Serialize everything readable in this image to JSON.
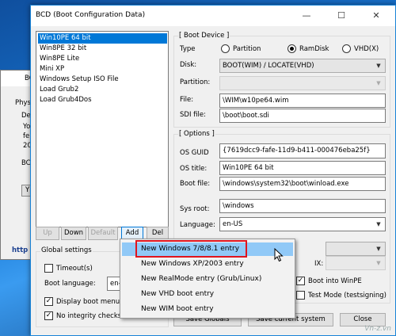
{
  "background_window": {
    "title_fragment": "BC",
    "tab_fragment": "Phys",
    "group_fragment": "De",
    "lines": [
      "Yo",
      "fe",
      "20"
    ],
    "group2_fragment": "BC",
    "button_fragment": "Y",
    "link_fragment": "http"
  },
  "window": {
    "title": "BCD (Boot Configuration Data)",
    "minimize": "—",
    "maximize": "☐",
    "close": "✕"
  },
  "entries": [
    {
      "label": "Win10PE 64 bit",
      "selected": true
    },
    {
      "label": "Win8PE 32 bit",
      "selected": false
    },
    {
      "label": "Win8PE Lite",
      "selected": false
    },
    {
      "label": "Mini XP",
      "selected": false
    },
    {
      "label": "Windows Setup ISO File",
      "selected": false
    },
    {
      "label": "Load Grub2",
      "selected": false
    },
    {
      "label": "Load Grub4Dos",
      "selected": false
    }
  ],
  "list_buttons": {
    "up": "Up",
    "down": "Down",
    "default": "Default",
    "add": "Add",
    "del": "Del"
  },
  "boot_device": {
    "group_label": "[ Boot Device ]",
    "type_label": "Type",
    "type_options": [
      "Partition",
      "RamDisk",
      "VHD(X)"
    ],
    "type_selected": "RamDisk",
    "disk_label": "Disk:",
    "disk_value": "BOOT(WIM) / LOCATE(VHD)",
    "partition_label": "Partition:",
    "partition_value": "",
    "file_label": "File:",
    "file_value": "\\WIM\\w10pe64.wim",
    "sdi_label": "SDI file:",
    "sdi_value": "\\boot\\boot.sdi"
  },
  "options": {
    "group_label": "[ Options ]",
    "guid_label": "OS GUID",
    "guid_value": "{7619dcc9-fafe-11d9-b411-000476eba25f}",
    "title_label": "OS title:",
    "title_value": "Win10PE 64 bit",
    "bootfile_label": "Boot file:",
    "bootfile_value": "\\windows\\system32\\boot\\winload.exe",
    "sysroot_label": "Sys root:",
    "sysroot_value": "\\windows",
    "language_label": "Language:",
    "language_value": "en-US",
    "nx_fragment": "IX:",
    "boot_winpe": "Boot into WinPE",
    "boot_winpe_checked": true,
    "test_mode": "Test Mode (testsigning)",
    "test_mode_checked": false
  },
  "global": {
    "group_label": "Global settings",
    "timeout_label": "Timeout(s)",
    "timeout_checked": false,
    "boot_language_label": "Boot language:",
    "boot_language_value": "en-",
    "display_menu_label": "Display boot menu",
    "display_menu_checked": true,
    "no_integrity_label": "No integrity checks",
    "no_integrity_checked": true
  },
  "bottom_buttons": {
    "save_globals": "Save Globals",
    "save_current": "Save current system",
    "close": "Close"
  },
  "menu": {
    "items": [
      "New Windows 7/8/8.1 entry",
      "New Windows XP/2003 entry",
      "New RealMode entry (Grub/Linux)",
      "New VHD boot entry",
      "New WIM boot entry"
    ],
    "highlighted_index": 0
  },
  "watermark": "Vn-z.vn",
  "colors": {
    "accent": "#0078d7",
    "highlight_box": "#e0141e",
    "menu_hover": "#91c9f7"
  }
}
